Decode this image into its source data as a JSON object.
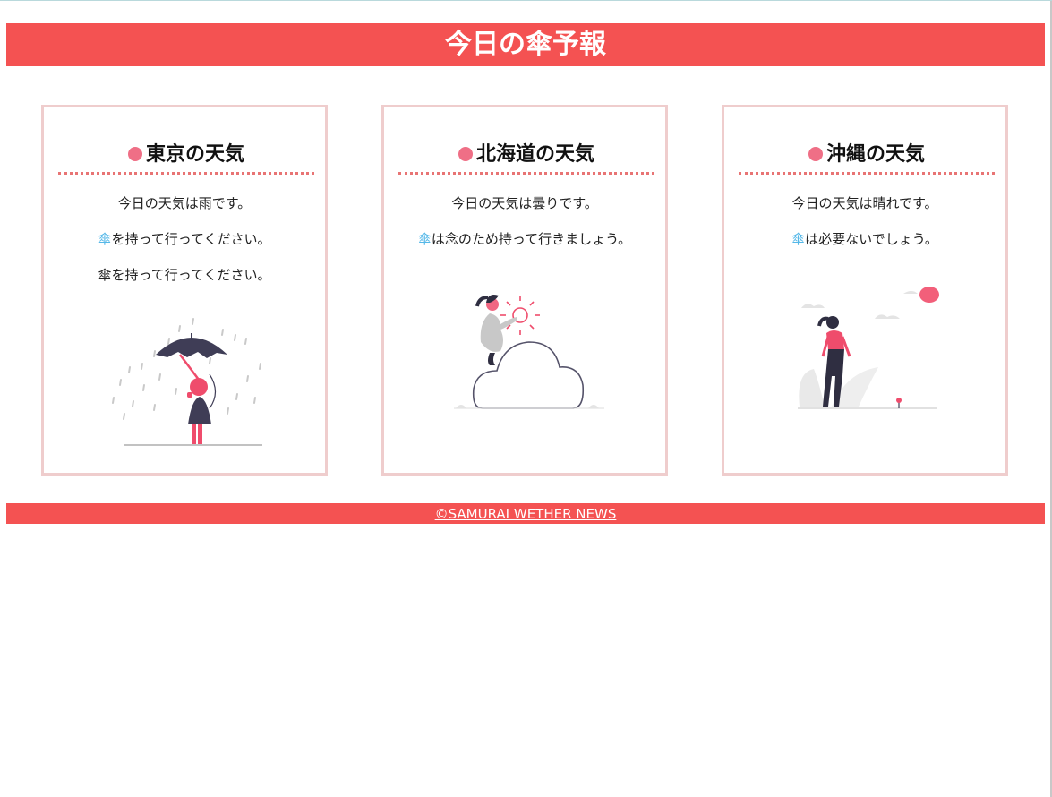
{
  "header": {
    "title": "今日の傘予報"
  },
  "cards": [
    {
      "title": "東京の天気",
      "line1": "今日の天気は雨です。",
      "line2_icon": "傘",
      "line2_text": "を持って行ってください。",
      "line3": "傘を持って行ってください。",
      "illustration": "woman-with-umbrella-in-rain-icon"
    },
    {
      "title": "北海道の天気",
      "line1": "今日の天気は曇りです。",
      "line2_icon": "傘",
      "line2_text": "は念のため持って行きましょう。",
      "illustration": "woman-on-cloud-with-sun-icon"
    },
    {
      "title": "沖縄の天気",
      "line1": "今日の天気は晴れです。",
      "line2_icon": "傘",
      "line2_text": "は必要ないでしょう。",
      "illustration": "woman-walking-sunny-day-icon"
    }
  ],
  "footer": {
    "text": "©SAMURAI WETHER NEWS"
  },
  "colors": {
    "brand": "#f45252",
    "card_border": "#efcdcd",
    "dot": "#ef6f86",
    "umbrella_char": "#55b8e8"
  }
}
